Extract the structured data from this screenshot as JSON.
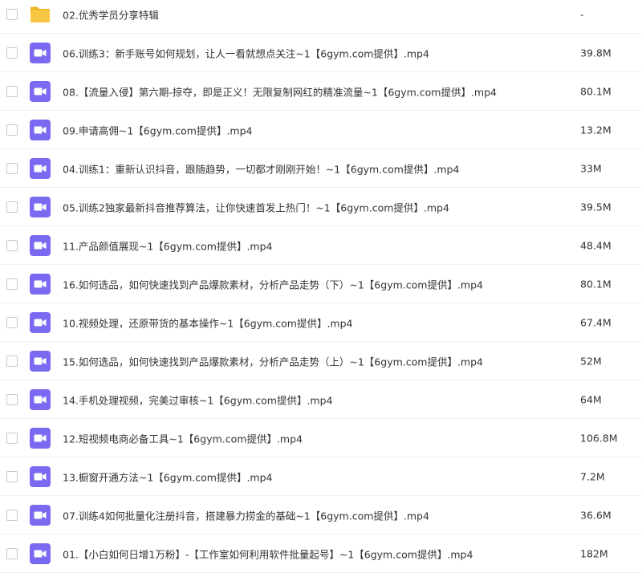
{
  "files": [
    {
      "icon": "folder-icon",
      "name": "02.优秀学员分享特辑",
      "size": "-"
    },
    {
      "icon": "video-icon",
      "name": "06.训练3：新手账号如何规划，让人一看就想点关注~1【6gym.com提供】.mp4",
      "size": "39.8M"
    },
    {
      "icon": "video-icon",
      "name": "08.【流量入侵】第六期-掠夺，即是正义！无限复制网红的精准流量~1【6gym.com提供】.mp4",
      "size": "80.1M"
    },
    {
      "icon": "video-icon",
      "name": "09.申请高佣~1【6gym.com提供】.mp4",
      "size": "13.2M"
    },
    {
      "icon": "video-icon",
      "name": "04.训练1：重新认识抖音，跟随趋势，一切都才刚刚开始！~1【6gym.com提供】.mp4",
      "size": "33M"
    },
    {
      "icon": "video-icon",
      "name": "05.训练2独家最新抖音推荐算法，让你快速首发上热门！~1【6gym.com提供】.mp4",
      "size": "39.5M"
    },
    {
      "icon": "video-icon",
      "name": "11.产品颜值展现~1【6gym.com提供】.mp4",
      "size": "48.4M"
    },
    {
      "icon": "video-icon",
      "name": "16.如何选品，如何快速找到产品爆款素材，分析产品走势（下）~1【6gym.com提供】.mp4",
      "size": "80.1M"
    },
    {
      "icon": "video-icon",
      "name": "10.视频处理，还原带货的基本操作~1【6gym.com提供】.mp4",
      "size": "67.4M"
    },
    {
      "icon": "video-icon",
      "name": "15.如何选品，如何快速找到产品爆款素材，分析产品走势（上）~1【6gym.com提供】.mp4",
      "size": "52M"
    },
    {
      "icon": "video-icon",
      "name": "14.手机处理视频，完美过审核~1【6gym.com提供】.mp4",
      "size": "64M"
    },
    {
      "icon": "video-icon",
      "name": "12.短视频电商必备工具~1【6gym.com提供】.mp4",
      "size": "106.8M"
    },
    {
      "icon": "video-icon",
      "name": "13.橱窗开通方法~1【6gym.com提供】.mp4",
      "size": "7.2M"
    },
    {
      "icon": "video-icon",
      "name": "07.训练4如何批量化注册抖音，搭建暴力捞金的基础~1【6gym.com提供】.mp4",
      "size": "36.6M"
    },
    {
      "icon": "video-icon",
      "name": "01.【小白如何日增1万粉】-【工作室如何利用软件批量起号】~1【6gym.com提供】.mp4",
      "size": "182M"
    }
  ],
  "colors": {
    "folder": "#f7c843",
    "folder_tab": "#eeb524",
    "video": "#7a6af1"
  }
}
